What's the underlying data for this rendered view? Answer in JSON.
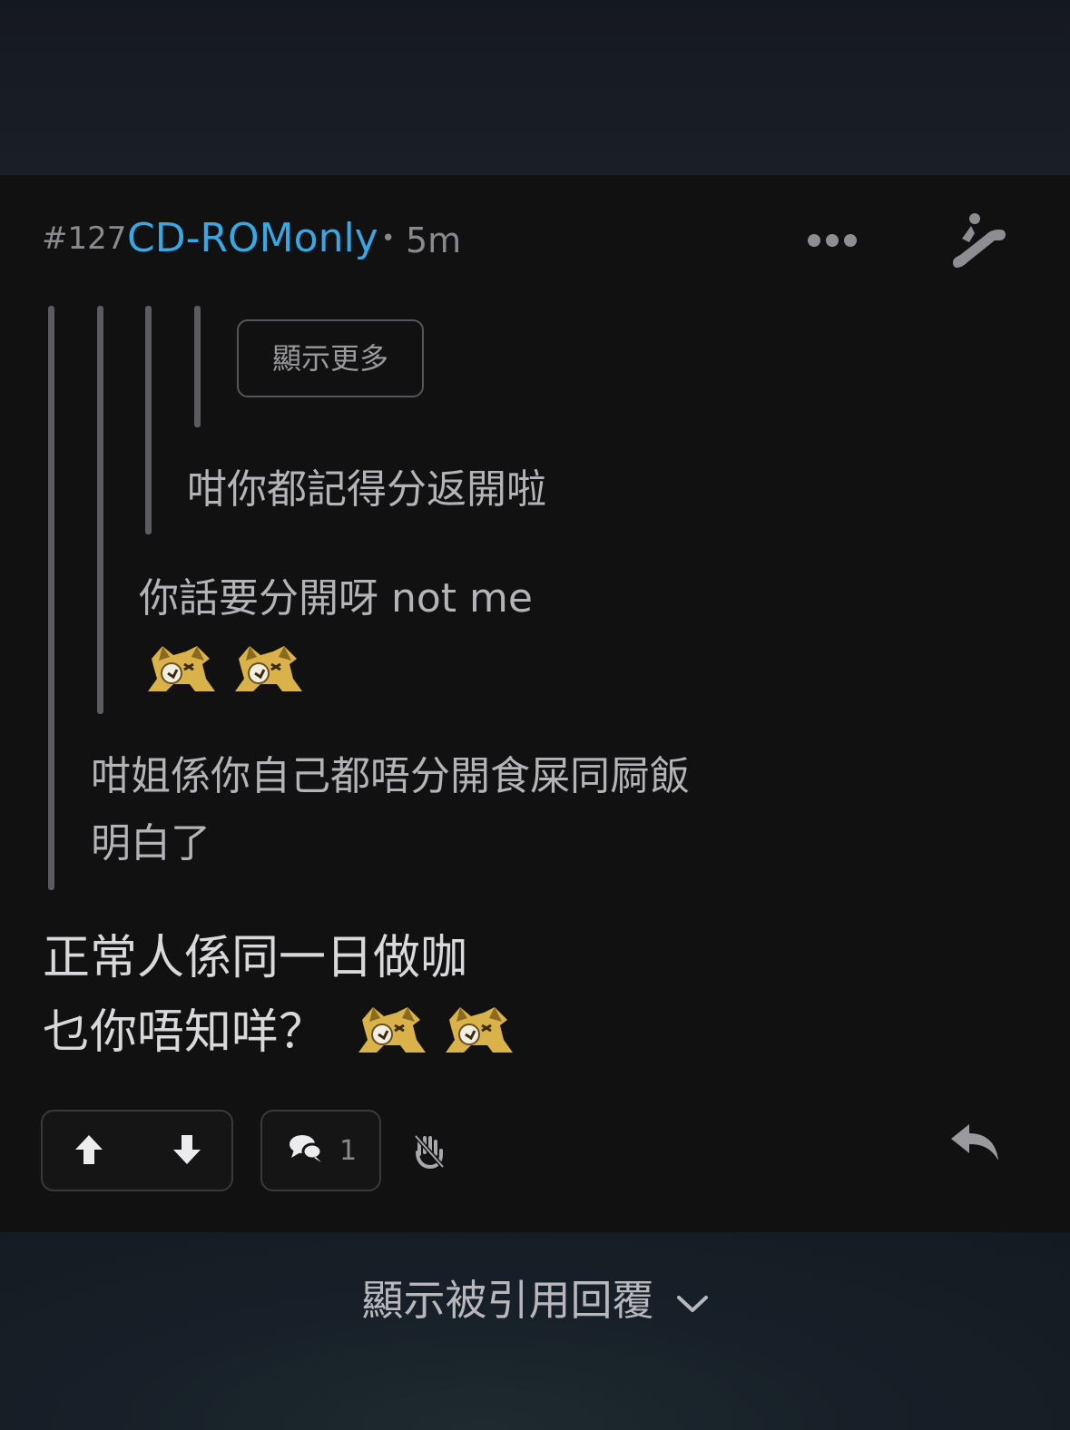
{
  "post": {
    "number": "#127",
    "author": "CD-ROMonly",
    "separator": "•",
    "time": "5m"
  },
  "header_icons": [
    "more-icon",
    "escalator-icon"
  ],
  "quote_chain": {
    "show_more_label": "顯示更多",
    "level3_text": "咁你都記得分返開啦",
    "level2_text": "你話要分開呀 not me",
    "level2_emojis": [
      "laughing-dog-emoji",
      "laughing-dog-emoji"
    ],
    "level1_lines": [
      "咁姐係你自己都唔分開食屎同屙飯",
      "明白了"
    ]
  },
  "reply": {
    "lines": [
      "正常人係同一日做咖",
      "乜你唔知咩？"
    ],
    "emojis": [
      "laughing-dog-emoji",
      "laughing-dog-emoji"
    ]
  },
  "actions": {
    "comment_count": "1",
    "icons": [
      "upvote-icon",
      "downvote-icon",
      "comment-icon",
      "hand-icon",
      "reply-icon"
    ]
  },
  "footer": {
    "show_quoted_replies": "顯示被引用回覆"
  },
  "colors": {
    "author": "#38a7e4",
    "background": "#111112",
    "emoji_gold": "#d9b24a"
  }
}
